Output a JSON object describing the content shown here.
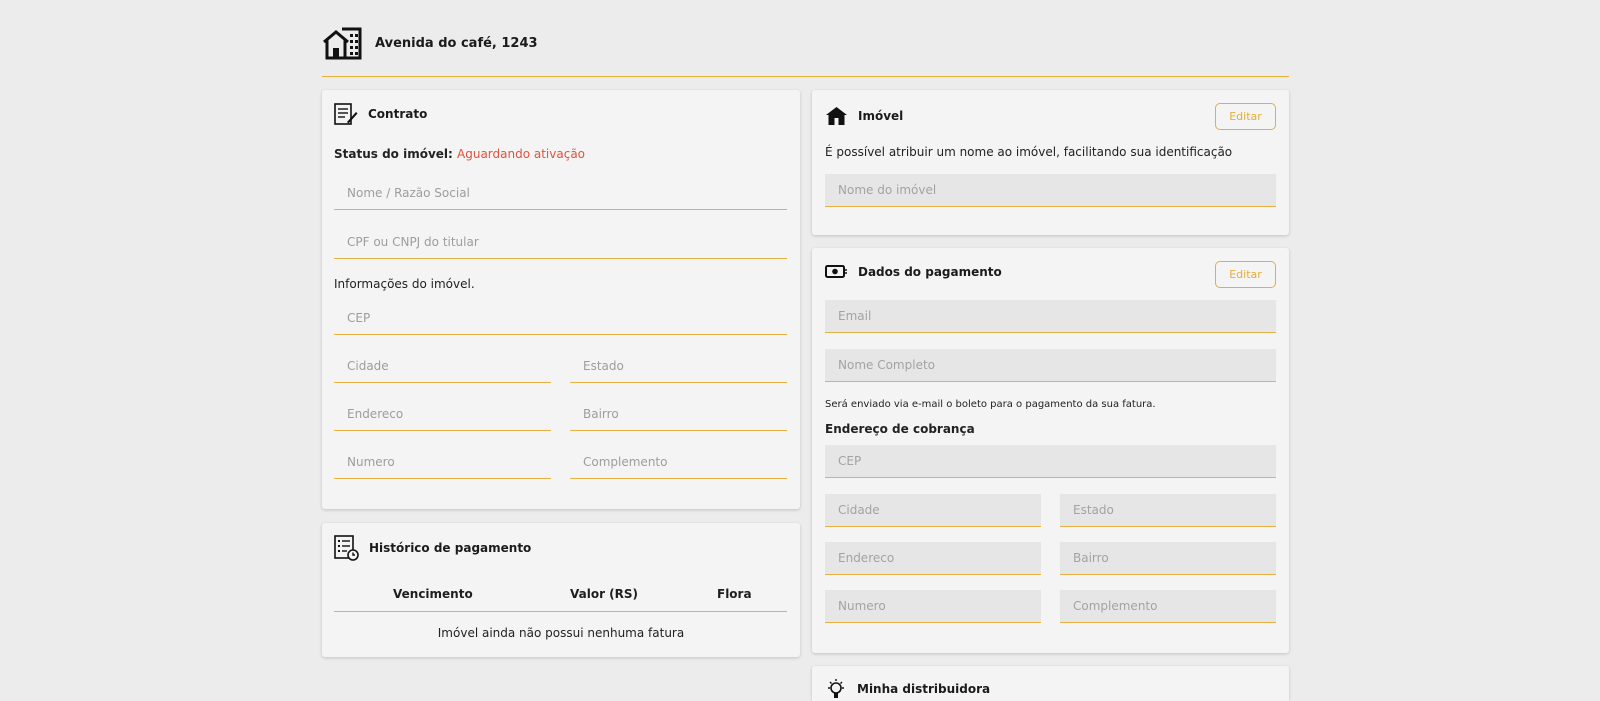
{
  "header": {
    "address": "Avenida do café, 1243"
  },
  "contrato": {
    "title": "Contrato",
    "status_label": "Status do imóvel:",
    "status_value": "Aguardando ativação",
    "fields": {
      "nome": "Nome / Razão Social",
      "cpf": "CPF ou CNPJ do titular"
    },
    "info_label": "Informações do imóvel.",
    "address_fields": {
      "cep": "CEP",
      "cidade": "Cidade",
      "estado": "Estado",
      "endereco": "Endereco",
      "bairro": "Bairro",
      "numero": "Numero",
      "complemento": "Complemento"
    }
  },
  "historico": {
    "title": "Histórico de pagamento",
    "columns": [
      "Vencimento",
      "Valor (RS)",
      "Flora"
    ],
    "empty_message": "Imóvel ainda não possui nenhuma fatura"
  },
  "imovel": {
    "title": "Imóvel",
    "edit_label": "Editar",
    "description": "É possível atribuir um nome ao imóvel, facilitando sua identificação",
    "name_placeholder": "Nome do imóvel"
  },
  "pagamento": {
    "title": "Dados do pagamento",
    "edit_label": "Editar",
    "email_placeholder": "Email",
    "fullname_placeholder": "Nome Completo",
    "notice": "Será enviado via e-mail o boleto para o pagamento da sua fatura.",
    "billing_title": "Endereço de cobrança",
    "address_fields": {
      "cep": "CEP",
      "cidade": "Cidade",
      "estado": "Estado",
      "endereco": "Endereco",
      "bairro": "Bairro",
      "numero": "Numero",
      "complemento": "Complemento"
    }
  },
  "distribuidora": {
    "title": "Minha distribuidora"
  },
  "colors": {
    "accent": "#e5ae3a",
    "status_pending": "#e0533d",
    "background": "#ececec",
    "card": "#f4f4f4"
  },
  "icons": [
    "building-icon",
    "contract-icon",
    "payment-history-icon",
    "house-icon",
    "money-icon",
    "lightbulb-icon"
  ]
}
